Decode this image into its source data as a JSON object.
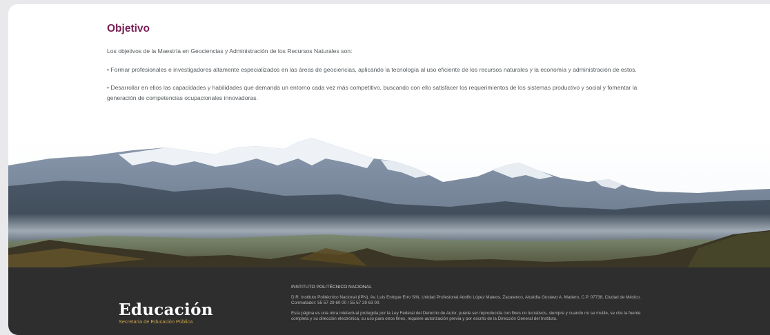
{
  "section": {
    "title": "Objetivo",
    "intro": "Los objetivos de la Maestría en Geociencias y Administración de los Recursos Naturales son:",
    "bullets": [
      "• Formar profesionales e investigadores altamente especializados en las áreas de geociencias, aplicando la tecnología al uso eficiente de los recursos naturales y la economía y administración de estos.",
      "• Desarrollar en ellos las capacidades y habilidades que demanda un entorno cada vez más competitivo, buscando con ello satisfacer los requerimientos de los sistemas productivo y social y fomentar la generación de competencias ocupacionales innovadoras."
    ]
  },
  "footer": {
    "logo_title": "Educación",
    "logo_subtitle": "Secretaría de Educación Pública",
    "institution": "INSTITUTO POLITÉCNICO NACIONAL",
    "address": "D.R. Instituto Politécnico Nacional (IPN). Av. Luis Enrique Erro S/N, Unidad Profesional Adolfo López Mateos, Zacatenco, Alcaldía Gustavo A. Madero, C.P. 07738, Ciudad de México. Conmutador: 55 57 29 60 00 / 55 57 29 63 00.",
    "legal": "Esta página es una obra intelectual protegida por la Ley Federal del Derecho de Autor, puede ser reproducida con fines no lucrativos, siempre y cuando no se mutile, se cite la fuente completa y su dirección electrónica; su uso para otros fines, requiere autorización previa y por escrito de la Dirección General del Instituto."
  },
  "colors": {
    "title": "#7a1f55",
    "footer_bg": "#2e2e2e",
    "logo_gold": "#c9a24b"
  }
}
